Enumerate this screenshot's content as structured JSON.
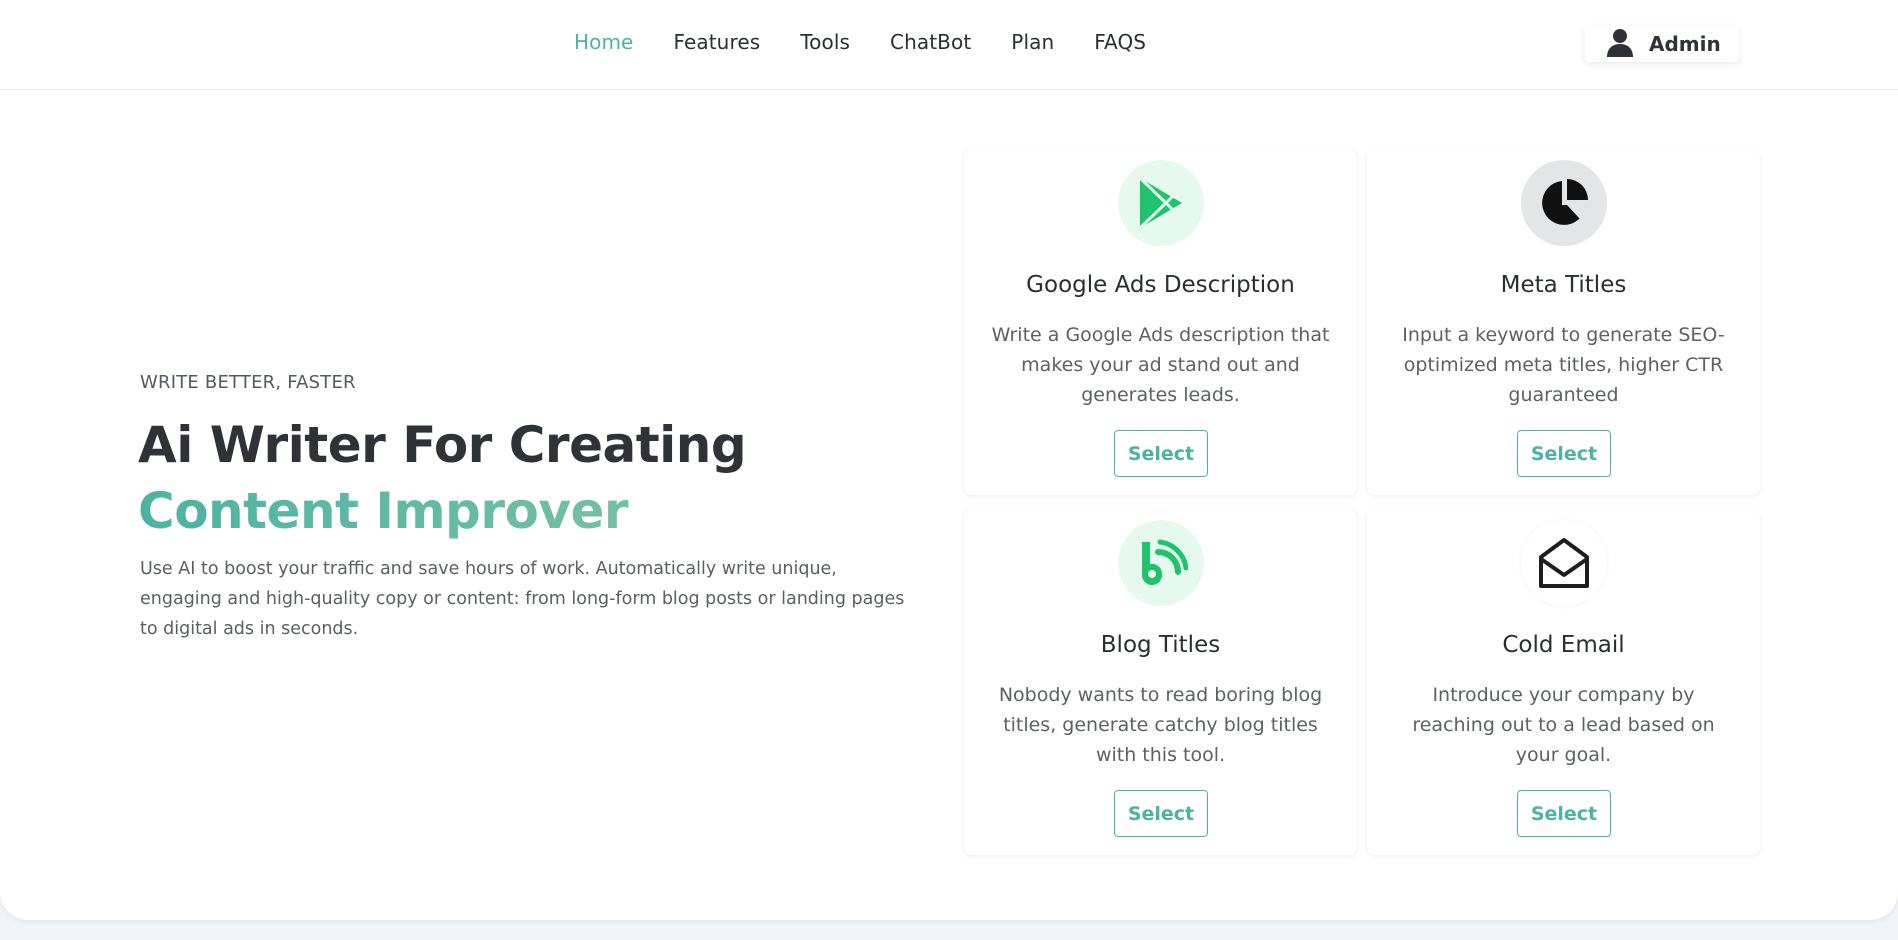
{
  "header": {
    "nav": [
      {
        "label": "Home",
        "active": true
      },
      {
        "label": "Features"
      },
      {
        "label": "Tools"
      },
      {
        "label": "ChatBot"
      },
      {
        "label": "Plan"
      },
      {
        "label": "FAQS"
      }
    ],
    "user_label": "Admin",
    "user_icon": "user-icon"
  },
  "hero": {
    "eyebrow": "WRITE BETTER, FASTER",
    "headline_line1": "Ai Writer For Creating",
    "headline_line2": "Content Improver",
    "description": "Use AI to boost your traffic and save hours of work. Automatically write unique, engaging and high-quality copy or content: from long-form blog posts or landing pages to digital ads in seconds."
  },
  "cards": [
    {
      "icon": "google-play-icon",
      "icon_bg": "#e6f9ef",
      "icon_color": "#1fc36b",
      "title": "Google Ads Description",
      "description": "Write a Google Ads description that makes your ad stand out and generates leads.",
      "button": "Select"
    },
    {
      "icon": "pie-chart-icon",
      "icon_bg": "#e4e5e7",
      "icon_color": "#111111",
      "title": "Meta Titles",
      "description": "Input a keyword to generate SEO-optimized meta titles, higher CTR guaranteed",
      "button": "Select"
    },
    {
      "icon": "blog-icon",
      "icon_bg": "#e6f9ef",
      "icon_color": "#1fc36b",
      "title": "Blog Titles",
      "description": "Nobody wants to read boring blog titles, generate catchy blog titles with this tool.",
      "button": "Select"
    },
    {
      "icon": "open-envelope-icon",
      "icon_bg": "#ffffff",
      "icon_color": "#1b1d20",
      "title": "Cold Email",
      "description": "Introduce your company by reaching out to a lead based on your goal.",
      "button": "Select"
    }
  ],
  "colors": {
    "accent": "#4cb3a3",
    "accent_end": "#7fc2a3",
    "text_dark": "#2f3337",
    "page_bg": "#f0f3f8"
  }
}
